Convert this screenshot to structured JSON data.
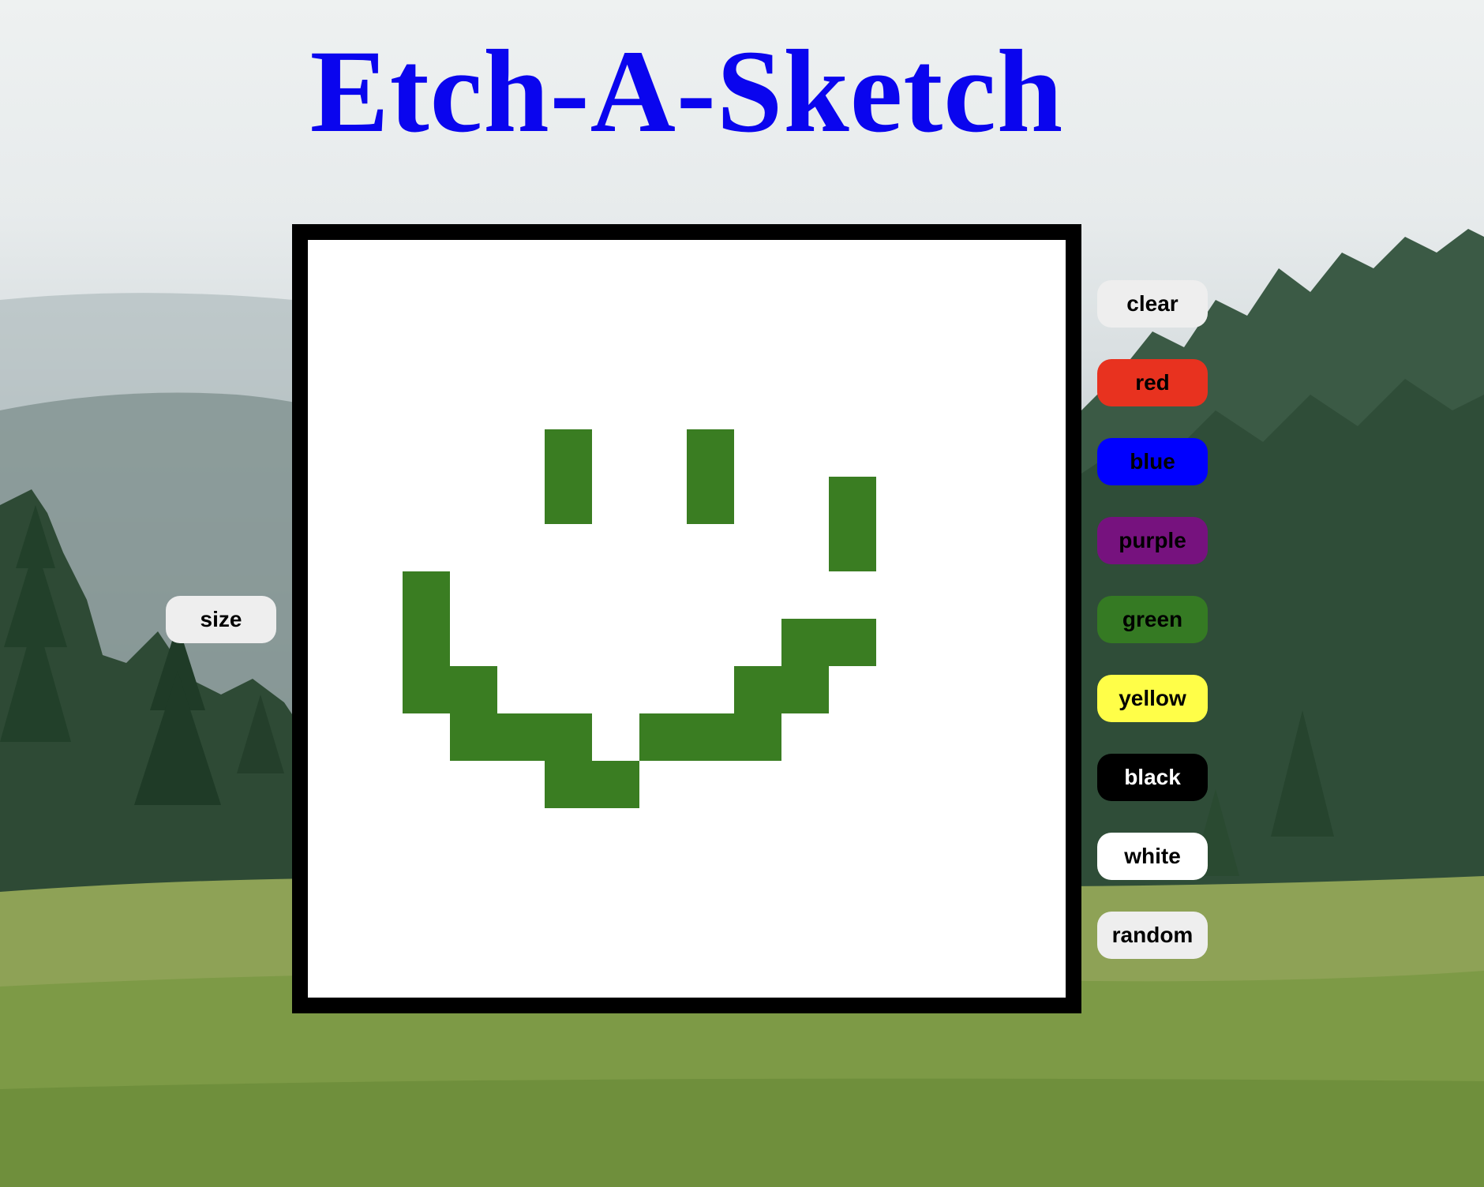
{
  "title": "Etch-A-Sketch",
  "colors": {
    "title": "#0a05ee",
    "frame": "#000000",
    "canvas": "#ffffff",
    "paint": "#3a7d22"
  },
  "size_button": {
    "label": "size",
    "bg": "#eeeeee",
    "fg": "#000000"
  },
  "color_buttons": [
    {
      "label": "clear",
      "bg": "#eeeeee",
      "fg": "#000000"
    },
    {
      "label": "red",
      "bg": "#e8321f",
      "fg": "#000000"
    },
    {
      "label": "blue",
      "bg": "#0000ff",
      "fg": "#000000"
    },
    {
      "label": "purple",
      "bg": "#76127e",
      "fg": "#000000"
    },
    {
      "label": "green",
      "bg": "#357a23",
      "fg": "#000000"
    },
    {
      "label": "yellow",
      "bg": "#fffe48",
      "fg": "#000000"
    },
    {
      "label": "black",
      "bg": "#000000",
      "fg": "#ffffff"
    },
    {
      "label": "white",
      "bg": "#ffffff",
      "fg": "#000000"
    },
    {
      "label": "random",
      "bg": "#eeeeee",
      "fg": "#000000"
    }
  ],
  "grid": {
    "size": 16,
    "painted_cells": [
      [
        4,
        5
      ],
      [
        4,
        8
      ],
      [
        5,
        5
      ],
      [
        5,
        8
      ],
      [
        5,
        11
      ],
      [
        6,
        11
      ],
      [
        7,
        2
      ],
      [
        8,
        2
      ],
      [
        8,
        10
      ],
      [
        8,
        11
      ],
      [
        9,
        2
      ],
      [
        9,
        3
      ],
      [
        9,
        9
      ],
      [
        9,
        10
      ],
      [
        10,
        3
      ],
      [
        10,
        4
      ],
      [
        10,
        5
      ],
      [
        10,
        7
      ],
      [
        10,
        8
      ],
      [
        10,
        9
      ],
      [
        11,
        5
      ],
      [
        11,
        6
      ]
    ]
  }
}
